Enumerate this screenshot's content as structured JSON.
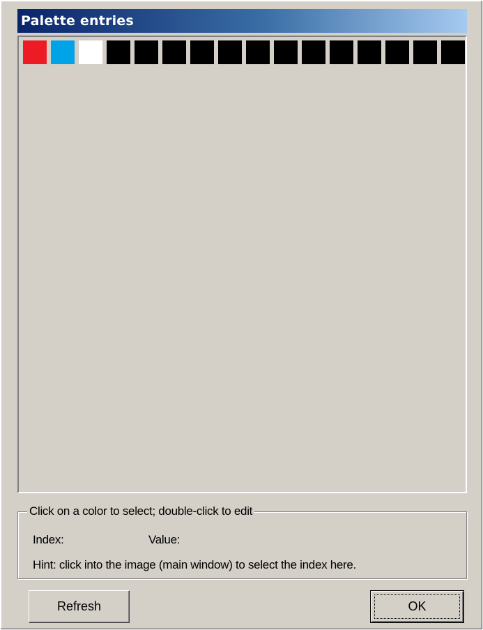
{
  "window": {
    "title": "Palette entries"
  },
  "palette": {
    "swatches": [
      {
        "index": 0,
        "color": "#ed1c24"
      },
      {
        "index": 1,
        "color": "#00a2e8"
      },
      {
        "index": 2,
        "color": "#ffffff"
      },
      {
        "index": 3,
        "color": "#000000"
      },
      {
        "index": 4,
        "color": "#000000"
      },
      {
        "index": 5,
        "color": "#000000"
      },
      {
        "index": 6,
        "color": "#000000"
      },
      {
        "index": 7,
        "color": "#000000"
      },
      {
        "index": 8,
        "color": "#000000"
      },
      {
        "index": 9,
        "color": "#000000"
      },
      {
        "index": 10,
        "color": "#000000"
      },
      {
        "index": 11,
        "color": "#000000"
      },
      {
        "index": 12,
        "color": "#000000"
      },
      {
        "index": 13,
        "color": "#000000"
      },
      {
        "index": 14,
        "color": "#000000"
      },
      {
        "index": 15,
        "color": "#000000"
      }
    ]
  },
  "info": {
    "group_label": "Click on a color to select; double-click to edit",
    "index_label": "Index:",
    "value_label": "Value:",
    "hint": "Hint: click into the image (main window) to select the index here."
  },
  "buttons": {
    "refresh": "Refresh",
    "ok": "OK"
  }
}
